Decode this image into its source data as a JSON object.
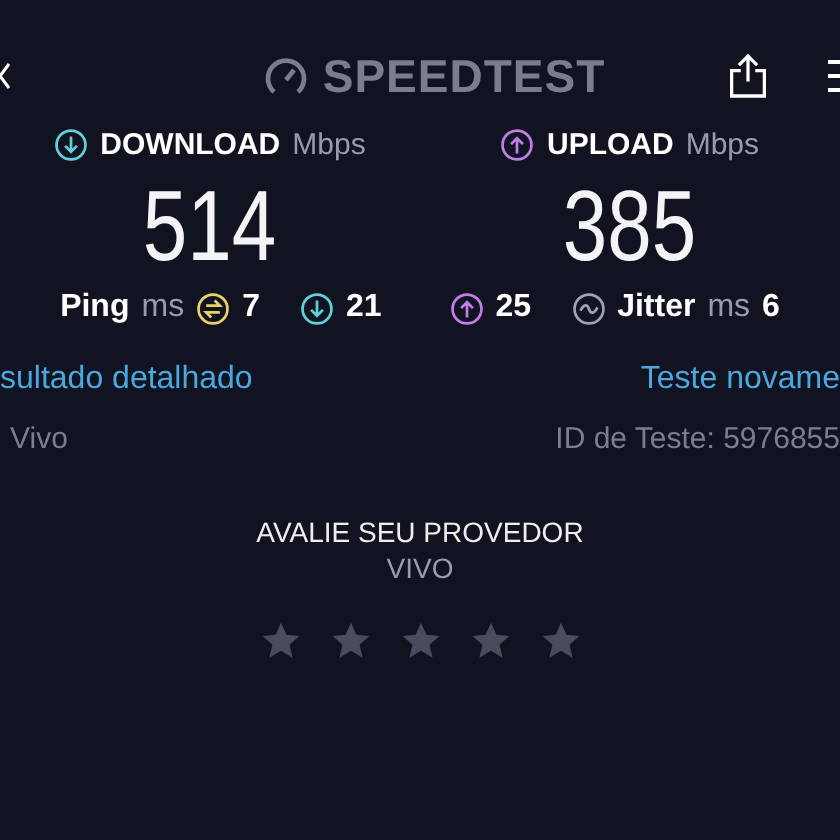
{
  "header": {
    "title": "SPEEDTEST"
  },
  "download": {
    "label": "DOWNLOAD",
    "unit": "Mbps",
    "value": "514"
  },
  "upload": {
    "label": "UPLOAD",
    "unit": "Mbps",
    "value": "385"
  },
  "ping": {
    "label": "Ping",
    "unit": "ms",
    "idle": "7",
    "download": "21",
    "upload": "25"
  },
  "jitter": {
    "label": "Jitter",
    "unit": "ms",
    "value": "6"
  },
  "links": {
    "left": "sultado detalhado",
    "right": "Teste novame"
  },
  "info": {
    "provider": "Vivo",
    "test_id": "ID de Teste: 5976855"
  },
  "rating": {
    "title": "AVALIE SEU PROVEDOR",
    "provider": "VIVO",
    "stars": 0
  }
}
